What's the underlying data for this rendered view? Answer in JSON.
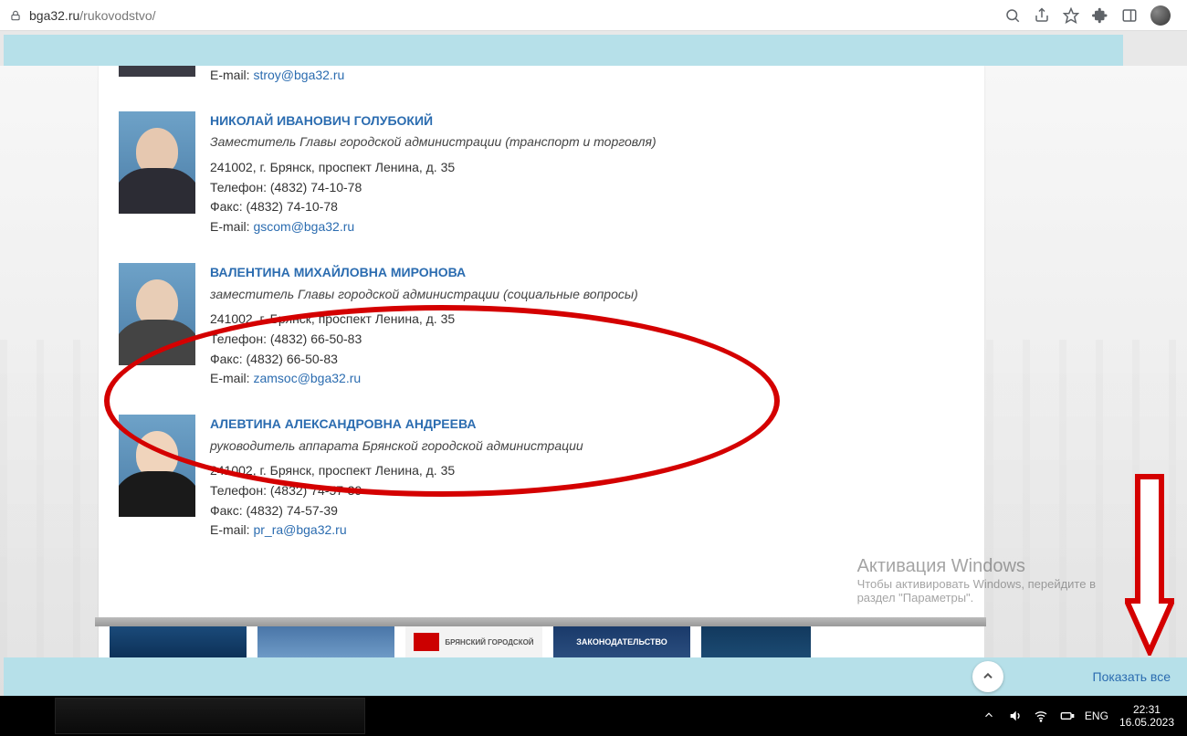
{
  "browser": {
    "url_domain": "bga32.ru",
    "url_path": "/rukovodstvo/"
  },
  "people": [
    {
      "name": "",
      "role": "",
      "address": "",
      "phone": "",
      "fax": "",
      "email_label": "E-mail: ",
      "email": "stroy@bga32.ru"
    },
    {
      "name": "НИКОЛАЙ ИВАНОВИЧ ГОЛУБОКИЙ",
      "role": "Заместитель Главы городской администрации (транспорт и торговля)",
      "address": "241002, г. Брянск, проспект Ленина, д. 35",
      "phone_label": "Телефон: ",
      "phone": "(4832) 74-10-78",
      "fax_label": "Факс: ",
      "fax": "(4832) 74-10-78",
      "email_label": "E-mail: ",
      "email": "gscom@bga32.ru"
    },
    {
      "name": "ВАЛЕНТИНА МИХАЙЛОВНА МИРОНОВА",
      "role": "заместитель Главы городской администрации (социальные вопросы)",
      "address": "241002, г. Брянск, проспект Ленина, д. 35",
      "phone_label": "Телефон: ",
      "phone": "(4832) 66-50-83",
      "fax_label": "Факс: ",
      "fax": "(4832) 66-50-83",
      "email_label": "E-mail: ",
      "email": "zamsoc@bga32.ru"
    },
    {
      "name": "АЛЕВТИНА АЛЕКСАНДРОВНА АНДРЕЕВА",
      "role": "руководитель аппарата Брянской городской администрации",
      "address": "241002, г. Брянск, проспект Ленина, д. 35",
      "phone_label": "Телефон: ",
      "phone": "(4832) 74-57-39",
      "fax_label": "Факс: ",
      "fax": "(4832) 74-57-39",
      "email_label": "E-mail: ",
      "email": "pr_ra@bga32.ru"
    }
  ],
  "banners": {
    "b3_text": "БРЯНСКИЙ ГОРОДСКОЙ",
    "b4_text": "ЗАКОНОДАТЕЛЬСТВО"
  },
  "windows_watermark": {
    "line1": "Активация Windows",
    "line2": "Чтобы активировать Windows, перейдите в",
    "line3": "раздел \"Параметры\"."
  },
  "lower": {
    "show_all": "Показать все"
  },
  "tray": {
    "lang": "ENG",
    "time": "22:31",
    "date": "16.05.2023"
  }
}
